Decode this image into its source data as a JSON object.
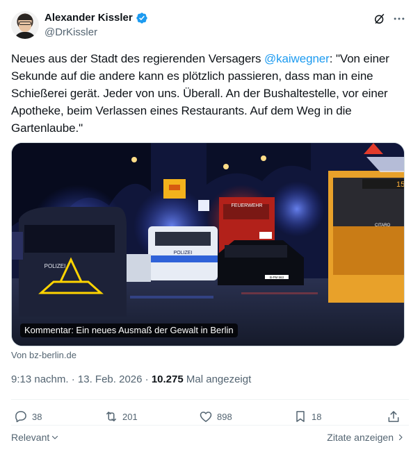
{
  "author": {
    "name": "Alexander Kissler",
    "handle": "@DrKissler",
    "verified": true
  },
  "tweet": {
    "text_before": "Neues aus der Stadt des regierenden Versagers ",
    "mention": "@kaiwegner",
    "text_after": ": \"Von einer Sekunde auf die andere kann es plötzlich passieren, dass man in eine Schießerei gerät. Jeder von uns. Überall. An der Bushaltestelle, vor einer Apotheke, beim Verlassen eines Restaurants. Auf dem Weg in die Gartenlaube.\""
  },
  "media": {
    "caption": "Kommentar: Ein neues Ausmaß der Gewalt in Berlin",
    "scene_labels": {
      "feuerwehr": "FEUERWEHR",
      "polizei_van": "POLIZEI",
      "polizei_car": "POLIZEI",
      "bus_number": "15",
      "bus_brand": "CITARO",
      "plate": "B-PM 563"
    }
  },
  "source": "Von bz-berlin.de",
  "meta": {
    "time": "9:13 nachm.",
    "separator": " · ",
    "date": "13. Feb. 2026",
    "views_count": "10.275",
    "views_label": " Mal angezeigt"
  },
  "actions": {
    "replies": "38",
    "reposts": "201",
    "likes": "898",
    "bookmarks": "18"
  },
  "footer": {
    "relevant_label": "Relevant",
    "quotes_label": "Zitate anzeigen"
  },
  "colors": {
    "accent": "#1d9bf0",
    "secondary_text": "#536471",
    "primary_text": "#0f1419",
    "divider": "#eff3f4"
  },
  "icons": [
    "verified-icon",
    "grok-icon",
    "more-icon",
    "reply-icon",
    "repost-icon",
    "like-icon",
    "bookmark-icon",
    "share-icon",
    "chevron-down-icon",
    "chevron-right-icon"
  ]
}
